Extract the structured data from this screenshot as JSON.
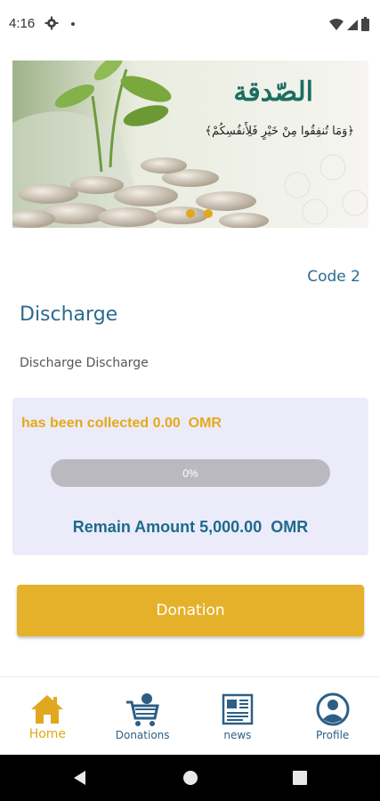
{
  "status_bar": {
    "time": "4:16"
  },
  "banner": {
    "title": "الصّدقة",
    "verse": "﴿وَمَا تُنفِقُوا مِنْ خَيْرٍ فَلِأَنفُسِكُمْ﴾",
    "slides": 2
  },
  "project": {
    "code": "Code 2",
    "title": "Discharge",
    "description": "Discharge Discharge"
  },
  "progress": {
    "collected_text": "has been collected 0.00  OMR",
    "percent_text": "0%",
    "percent_value": 0,
    "remain_text": "Remain Amount 5,000.00  OMR"
  },
  "actions": {
    "donate_label": "Donation"
  },
  "bottom_nav": {
    "items": [
      {
        "label": "Home",
        "icon": "home-icon",
        "active": true
      },
      {
        "label": "Donations",
        "icon": "cart-donations-icon",
        "active": false
      },
      {
        "label": "news",
        "icon": "newspaper-icon",
        "active": false
      },
      {
        "label": "Profile",
        "icon": "profile-icon",
        "active": false
      }
    ]
  },
  "colors": {
    "accent": "#e5b12b",
    "primary": "#2d6a8f",
    "card_bg": "#ecebfa"
  }
}
